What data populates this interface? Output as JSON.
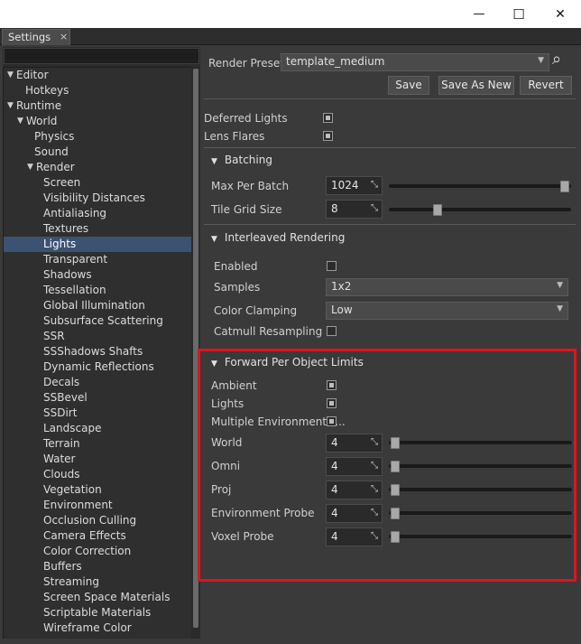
{
  "window": {
    "minimize_glyph": "—",
    "maximize_glyph": "☐",
    "close_glyph": "✕"
  },
  "tab": {
    "label": "Settings",
    "close_glyph": "×"
  },
  "tree": {
    "items": [
      {
        "label": "Editor",
        "arrow": "▼",
        "indent": 0
      },
      {
        "label": "Hotkeys",
        "arrow": "",
        "indent": 1
      },
      {
        "label": "Runtime",
        "arrow": "▼",
        "indent": 0
      },
      {
        "label": "World",
        "arrow": "▼",
        "indent": 1
      },
      {
        "label": "Physics",
        "arrow": "",
        "indent": 2
      },
      {
        "label": "Sound",
        "arrow": "",
        "indent": 2
      },
      {
        "label": "Render",
        "arrow": "▼",
        "indent": 2
      },
      {
        "label": "Screen",
        "arrow": "",
        "indent": 3
      },
      {
        "label": "Visibility Distances",
        "arrow": "",
        "indent": 3
      },
      {
        "label": "Antialiasing",
        "arrow": "",
        "indent": 3
      },
      {
        "label": "Textures",
        "arrow": "",
        "indent": 3
      },
      {
        "label": "Lights",
        "arrow": "",
        "indent": 3,
        "selected": true
      },
      {
        "label": "Transparent",
        "arrow": "",
        "indent": 3
      },
      {
        "label": "Shadows",
        "arrow": "",
        "indent": 3
      },
      {
        "label": "Tessellation",
        "arrow": "",
        "indent": 3
      },
      {
        "label": "Global Illumination",
        "arrow": "",
        "indent": 3
      },
      {
        "label": "Subsurface Scattering",
        "arrow": "",
        "indent": 3
      },
      {
        "label": "SSR",
        "arrow": "",
        "indent": 3
      },
      {
        "label": "SSShadows Shafts",
        "arrow": "",
        "indent": 3
      },
      {
        "label": "Dynamic Reflections",
        "arrow": "",
        "indent": 3
      },
      {
        "label": "Decals",
        "arrow": "",
        "indent": 3
      },
      {
        "label": "SSBevel",
        "arrow": "",
        "indent": 3
      },
      {
        "label": "SSDirt",
        "arrow": "",
        "indent": 3
      },
      {
        "label": "Landscape",
        "arrow": "",
        "indent": 3
      },
      {
        "label": "Terrain",
        "arrow": "",
        "indent": 3
      },
      {
        "label": "Water",
        "arrow": "",
        "indent": 3
      },
      {
        "label": "Clouds",
        "arrow": "",
        "indent": 3
      },
      {
        "label": "Vegetation",
        "arrow": "",
        "indent": 3
      },
      {
        "label": "Environment",
        "arrow": "",
        "indent": 3
      },
      {
        "label": "Occlusion Culling",
        "arrow": "",
        "indent": 3
      },
      {
        "label": "Camera Effects",
        "arrow": "",
        "indent": 3
      },
      {
        "label": "Color Correction",
        "arrow": "",
        "indent": 3
      },
      {
        "label": "Buffers",
        "arrow": "",
        "indent": 3
      },
      {
        "label": "Streaming",
        "arrow": "",
        "indent": 3
      },
      {
        "label": "Screen Space Materials",
        "arrow": "",
        "indent": 3
      },
      {
        "label": "Scriptable Materials",
        "arrow": "",
        "indent": 3
      },
      {
        "label": "Wireframe Color",
        "arrow": "",
        "indent": 3
      }
    ]
  },
  "preset": {
    "label": "Render Preset:",
    "value": "template_medium",
    "save": "Save",
    "save_as_new": "Save As New",
    "revert": "Revert"
  },
  "lights": {
    "deferred_lights": {
      "label": "Deferred Lights",
      "checked": true
    },
    "lens_flares": {
      "label": "Lens Flares",
      "checked": true
    }
  },
  "batching": {
    "title": "Batching",
    "max_per_batch": {
      "label": "Max Per Batch",
      "value": "1024",
      "fraction": 1.0
    },
    "tile_grid_size": {
      "label": "Tile Grid Size",
      "value": "8",
      "fraction": 0.25
    }
  },
  "interleaved": {
    "title": "Interleaved Rendering",
    "enabled": {
      "label": "Enabled",
      "checked": false
    },
    "samples": {
      "label": "Samples",
      "value": "1x2"
    },
    "color_clamping": {
      "label": "Color Clamping",
      "value": "Low"
    },
    "catmull": {
      "label": "Catmull Resampling",
      "checked": false
    }
  },
  "forward": {
    "title": "Forward Per Object Limits",
    "ambient": {
      "label": "Ambient",
      "checked": true
    },
    "lights": {
      "label": "Lights",
      "checked": true
    },
    "multi_env": {
      "label": "Multiple Environment P...",
      "checked": true
    },
    "world": {
      "label": "World",
      "value": "4",
      "fraction": 0.0
    },
    "omni": {
      "label": "Omni",
      "value": "4",
      "fraction": 0.0
    },
    "proj": {
      "label": "Proj",
      "value": "4",
      "fraction": 0.0
    },
    "env_probe": {
      "label": "Environment Probe",
      "value": "4",
      "fraction": 0.0
    },
    "voxel_probe": {
      "label": "Voxel Probe",
      "value": "4",
      "fraction": 0.0
    }
  },
  "glyphs": {
    "dropdown": "▼",
    "expand": "▼",
    "spin_handle": "⤡",
    "search": "⌕"
  },
  "colors": {
    "selection": "#3c5273",
    "highlight_box": "#e0141e"
  }
}
